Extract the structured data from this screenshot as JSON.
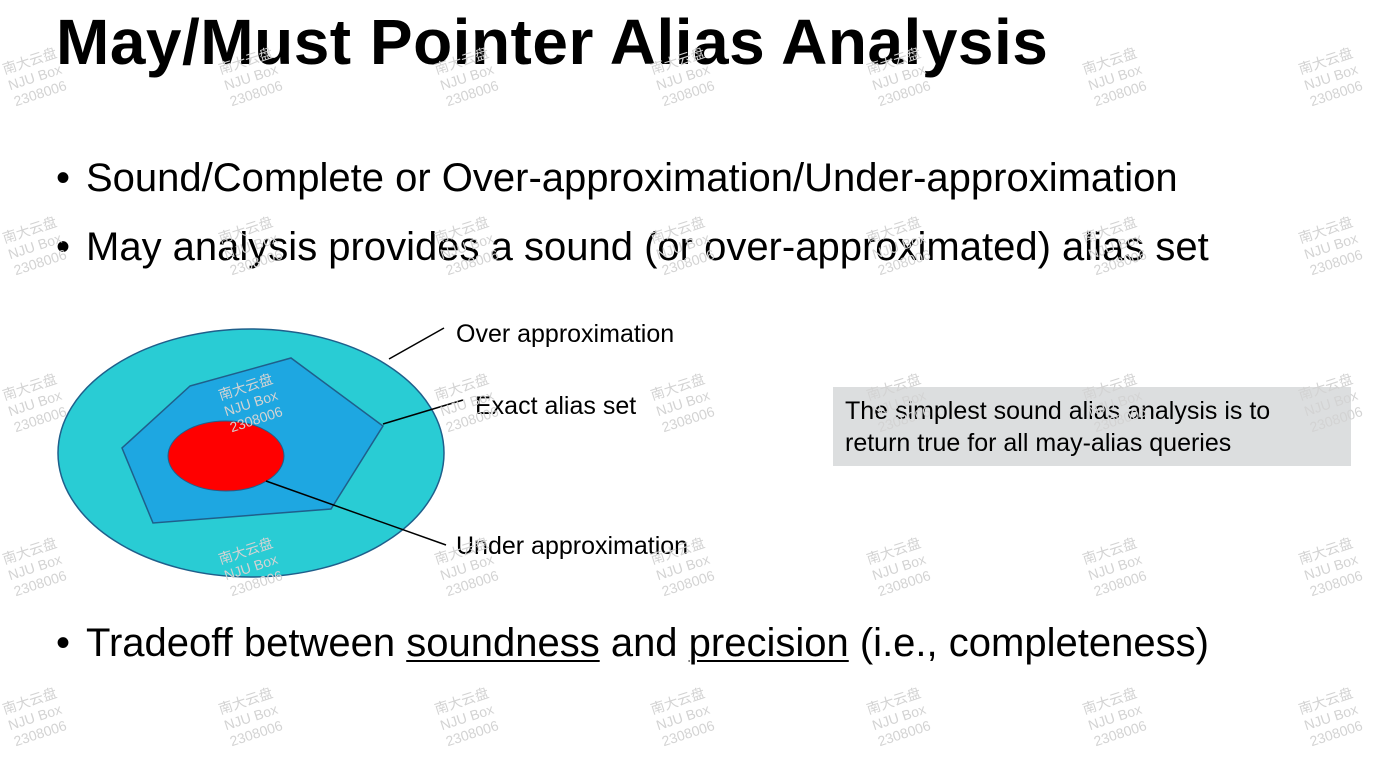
{
  "slide": {
    "title": "May/Must Pointer Alias Analysis",
    "bullet_symbol": "•",
    "bullets": [
      "Sound/Complete or Over-approximation/Under-approximation",
      "May analysis provides a sound (or over-approximated) alias set"
    ],
    "tradeoff": {
      "before": "Tradeoff between ",
      "term1": "soundness",
      "middle": " and ",
      "term2": "precision",
      "after": " (i.e., completeness)"
    }
  },
  "diagram": {
    "labels": {
      "over": "Over approximation",
      "exact": "Exact alias set",
      "under": "Under approximation"
    },
    "colors": {
      "over": "#29ccd4",
      "exact": "#1ea7e1",
      "under": "#ff0000",
      "outline": "#1f5f8b"
    }
  },
  "note": {
    "line1": "The simplest sound alias analysis is to",
    "line2": "return true for all may-alias queries"
  },
  "watermark": {
    "line1": "南大云盘",
    "line2": "NJU Box",
    "line3": "2308006"
  }
}
